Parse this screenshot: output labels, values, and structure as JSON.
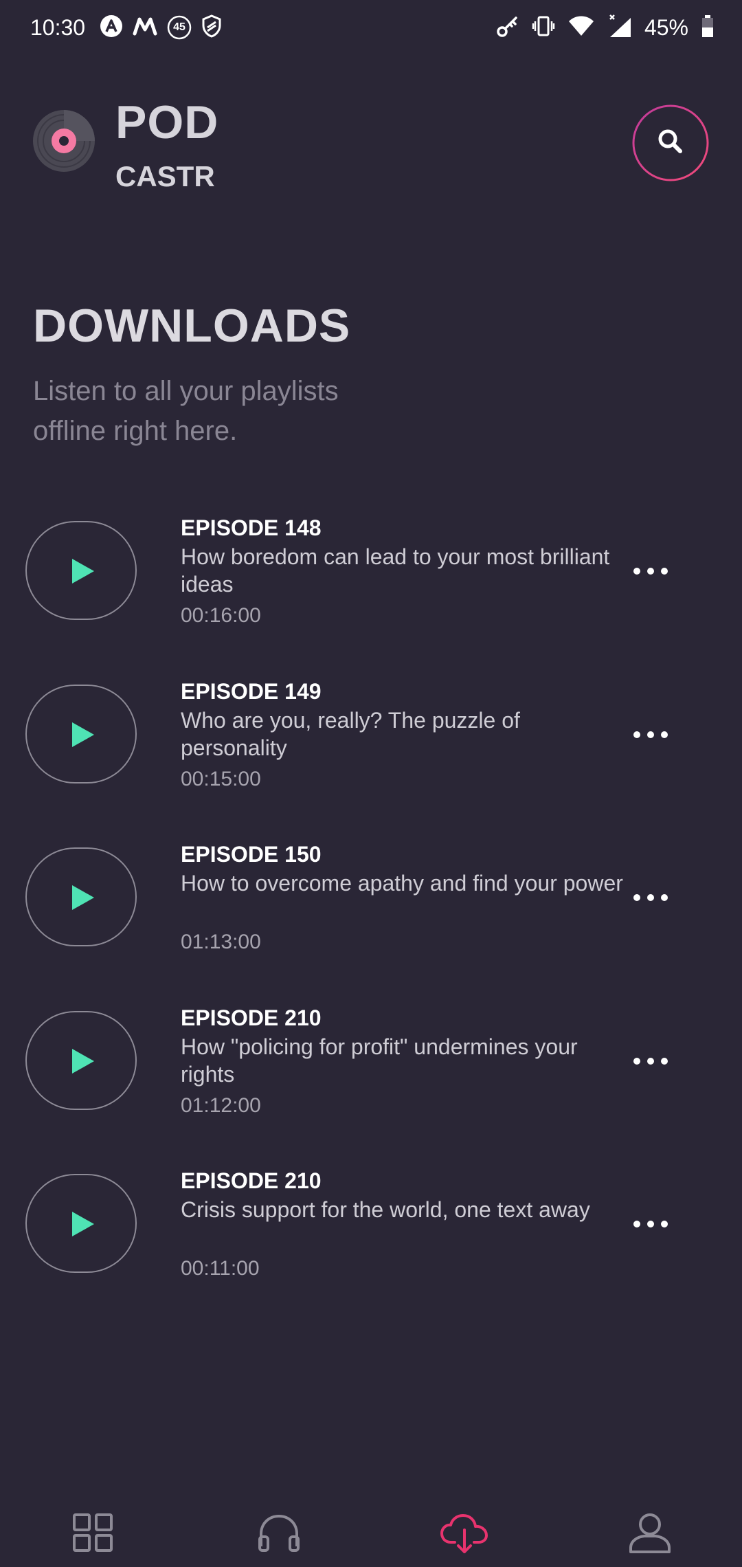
{
  "status_bar": {
    "time": "10:30",
    "badge_number": "45",
    "battery_percent": "45%",
    "icons_left": [
      "assistant-icon",
      "maps-m-icon",
      "notification-45-icon",
      "shield-icon"
    ],
    "icons_right": [
      "vpn-key-icon",
      "vibrate-icon",
      "wifi-icon",
      "cell-signal-icon",
      "battery-icon"
    ]
  },
  "header": {
    "brand_title": "POD",
    "brand_subtitle": "CASTR",
    "logo_icon": "vinyl-disc-icon",
    "search_icon": "search-icon",
    "accent_gradient": [
      "#c13b9b",
      "#f24a7a"
    ]
  },
  "page": {
    "title": "DOWNLOADS",
    "subtitle": "Listen to all your playlists offline right here."
  },
  "episodes": [
    {
      "title": "EPISODE 148",
      "description": "How boredom can lead to your most brilliant ideas",
      "duration": "00:16:00"
    },
    {
      "title": "EPISODE 149",
      "description": "Who are you, really? The puzzle of personality",
      "duration": "00:15:00"
    },
    {
      "title": "EPISODE 150",
      "description": "How to overcome apathy and find your power",
      "duration": "01:13:00"
    },
    {
      "title": "EPISODE 210",
      "description": "How \"policing for profit\" undermines your rights",
      "duration": "01:12:00"
    },
    {
      "title": "EPISODE 210",
      "description": "Crisis support for the world, one text away",
      "duration": "00:11:00"
    }
  ],
  "bottom_nav": {
    "items": [
      {
        "name": "home",
        "icon": "grid-icon",
        "active": false
      },
      {
        "name": "listen",
        "icon": "headphones-icon",
        "active": false
      },
      {
        "name": "downloads",
        "icon": "cloud-download-icon",
        "active": true
      },
      {
        "name": "profile",
        "icon": "user-icon",
        "active": false
      }
    ],
    "active_color": "#e8336e",
    "inactive_color": "#8d8a96"
  },
  "colors": {
    "background": "#2a2636",
    "play_accent": "#4fe3b4",
    "logo_accent": "#f57aa3"
  }
}
